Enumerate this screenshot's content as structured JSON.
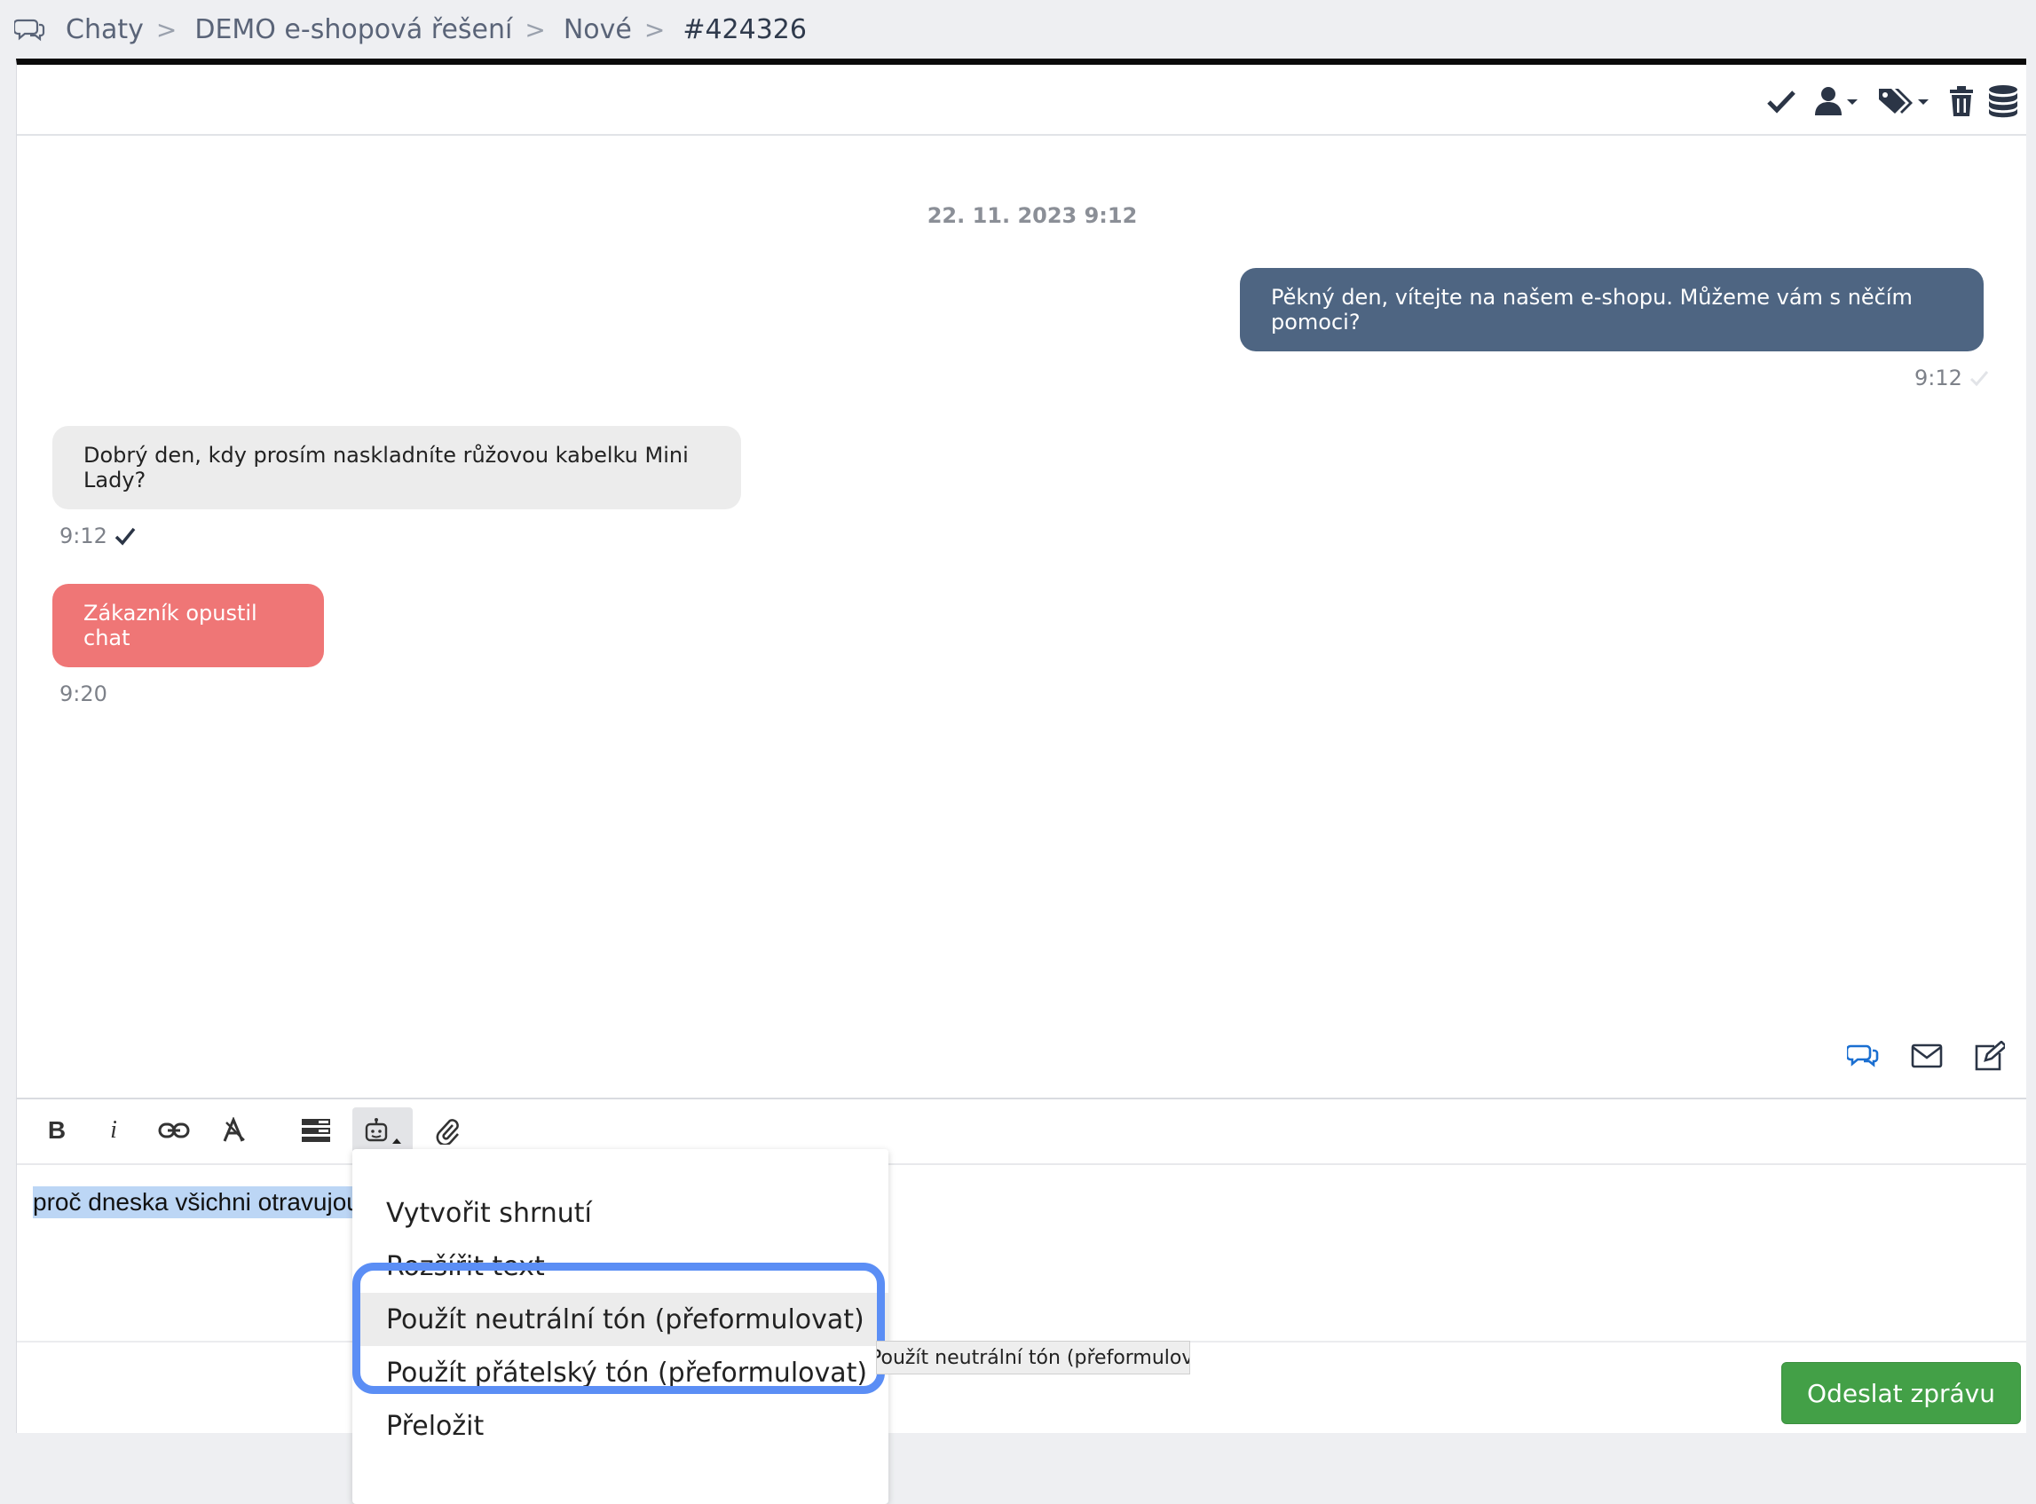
{
  "breadcrumb": {
    "items": [
      "Chaty",
      "DEMO e-shopová řešení",
      "Nové",
      "#424326"
    ],
    "separator": ">"
  },
  "toolbar_icons": [
    "check-icon",
    "user-icon",
    "tags-icon",
    "trash-icon",
    "database-icon"
  ],
  "chat": {
    "date": "22. 11. 2023 9:12",
    "messages": [
      {
        "role": "agent",
        "text": "Pěkný den, vítejte na našem e-shopu. Můžeme vám s něčím pomoci?",
        "time": "9:12"
      },
      {
        "role": "customer",
        "text": "Dobrý den, kdy prosím naskladníte růžovou kabelku Mini Lady?",
        "time": "9:12"
      },
      {
        "role": "system",
        "text": "Zákazník opustil chat",
        "time": "9:20"
      }
    ]
  },
  "editor": {
    "text": "proč dneska všichni otravujou",
    "send_label": "Odeslat zprávu",
    "toolbar": [
      "B",
      "i"
    ]
  },
  "ai_menu": {
    "items": [
      "Vytvořit shrnutí",
      "Rozšířit text",
      "Použít neutrální tón (přeformulovat)",
      "Použít přátelský tón (přeformulovat)",
      "Přeložit"
    ],
    "tooltip": "Použít neutrální tón (přeformulovat)"
  },
  "colors": {
    "agent_bubble": "#4e6582",
    "customer_bubble": "#ececec",
    "system_bubble": "#ef7676",
    "send_button": "#43a047",
    "highlight": "#5b8ef5"
  }
}
